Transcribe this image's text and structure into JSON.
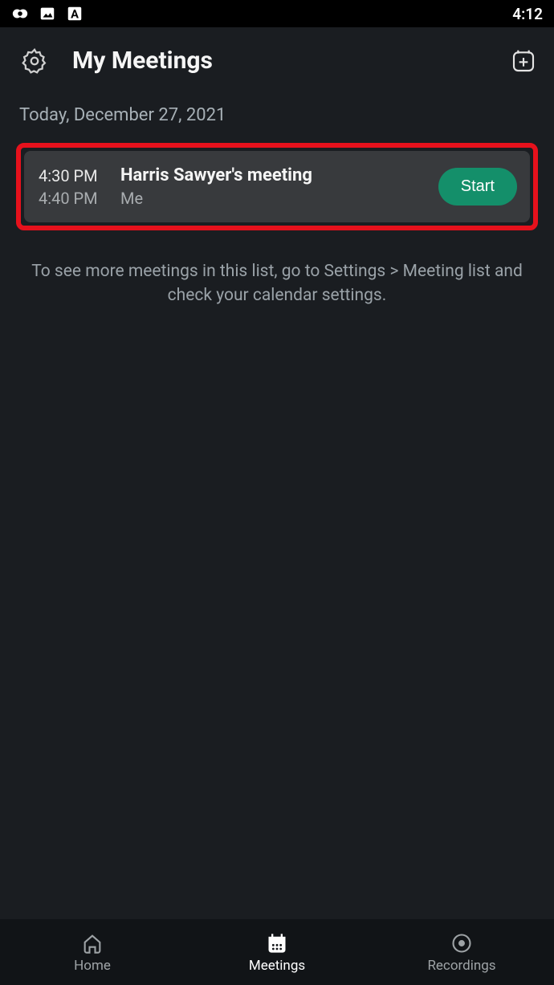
{
  "status_bar": {
    "time": "4:12"
  },
  "header": {
    "title": "My Meetings"
  },
  "date_header": "Today,  December 27, 2021",
  "meeting": {
    "start_time": "4:30 PM",
    "end_time": "4:40 PM",
    "title": "Harris Sawyer's meeting",
    "organizer": "Me",
    "start_label": "Start"
  },
  "hint": "To see more meetings in this list, go to Settings > Meeting list and check your calendar settings.",
  "nav": {
    "home": "Home",
    "meetings": "Meetings",
    "recordings": "Recordings"
  }
}
